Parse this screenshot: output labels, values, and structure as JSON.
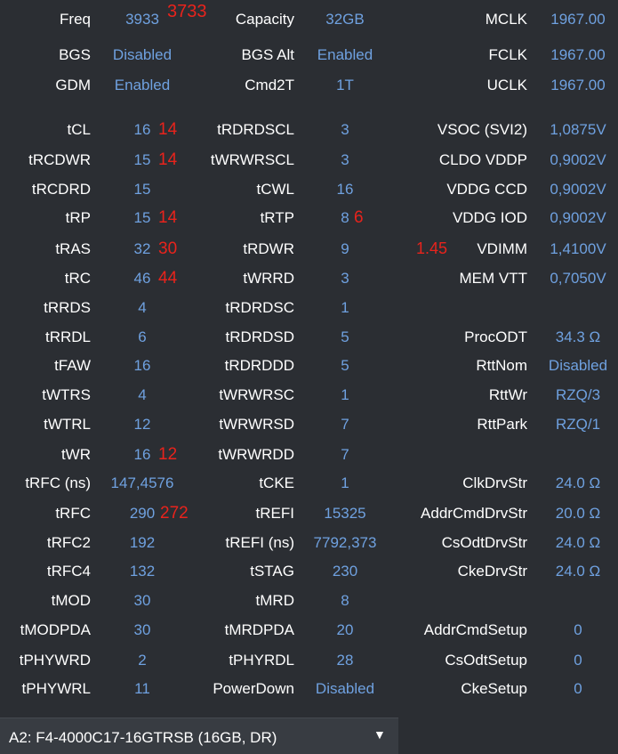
{
  "rows": [
    {
      "l1": "Freq",
      "v1": "3933",
      "a1": "3733",
      "l2": "Capacity",
      "v2": "32GB",
      "l3": "MCLK",
      "v3": "1967.00"
    },
    {
      "l1": "BGS",
      "v1": "Disabled",
      "l2": "BGS Alt",
      "v2": "Enabled",
      "l3": "FCLK",
      "v3": "1967.00"
    },
    {
      "l1": "GDM",
      "v1": "Enabled",
      "l2": "Cmd2T",
      "v2": "1T",
      "l3": "UCLK",
      "v3": "1967.00"
    },
    {
      "l1": "tCL",
      "v1": "16",
      "a1": "14",
      "l2": "tRDRDSCL",
      "v2": "3",
      "l3": "VSOC (SVI2)",
      "v3": "1,0875V"
    },
    {
      "l1": "tRCDWR",
      "v1": "15",
      "a1": "14",
      "l2": "tWRWRSCL",
      "v2": "3",
      "l3": "CLDO VDDP",
      "v3": "0,9002V"
    },
    {
      "l1": "tRCDRD",
      "v1": "15",
      "l2": "tCWL",
      "v2": "16",
      "l3": "VDDG CCD",
      "v3": "0,9002V"
    },
    {
      "l1": "tRP",
      "v1": "15",
      "a1": "14",
      "l2": "tRTP",
      "v2": "8",
      "a2": "6",
      "l3": "VDDG IOD",
      "v3": "0,9002V"
    },
    {
      "l1": "tRAS",
      "v1": "32",
      "a1": "30",
      "l2": "tRDWR",
      "v2": "9",
      "a3": "1.45",
      "l3": "VDIMM",
      "v3": "1,4100V"
    },
    {
      "l1": "tRC",
      "v1": "46",
      "a1": "44",
      "l2": "tWRRD",
      "v2": "3",
      "l3": "MEM VTT",
      "v3": "0,7050V"
    },
    {
      "l1": "tRRDS",
      "v1": "4",
      "l2": "tRDRDSC",
      "v2": "1",
      "l3": "",
      "v3": ""
    },
    {
      "l1": "tRRDL",
      "v1": "6",
      "l2": "tRDRDSD",
      "v2": "5",
      "l3": "ProcODT",
      "v3": "34.3 Ω"
    },
    {
      "l1": "tFAW",
      "v1": "16",
      "l2": "tRDRDDD",
      "v2": "5",
      "l3": "RttNom",
      "v3": "Disabled"
    },
    {
      "l1": "tWTRS",
      "v1": "4",
      "l2": "tWRWRSC",
      "v2": "1",
      "l3": "RttWr",
      "v3": "RZQ/3"
    },
    {
      "l1": "tWTRL",
      "v1": "12",
      "l2": "tWRWRSD",
      "v2": "7",
      "l3": "RttPark",
      "v3": "RZQ/1"
    },
    {
      "l1": "tWR",
      "v1": "16",
      "a1": "12",
      "l2": "tWRWRDD",
      "v2": "7",
      "l3": "",
      "v3": ""
    },
    {
      "l1": "tRFC (ns)",
      "v1": "147,4576",
      "l2": "tCKE",
      "v2": "1",
      "l3": "ClkDrvStr",
      "v3": "24.0 Ω"
    },
    {
      "l1": "tRFC",
      "v1": "290",
      "a1": "272",
      "l2": "tREFI",
      "v2": "15325",
      "l3": "AddrCmdDrvStr",
      "v3": "20.0 Ω"
    },
    {
      "l1": "tRFC2",
      "v1": "192",
      "l2": "tREFI (ns)",
      "v2": "7792,373",
      "l3": "CsOdtDrvStr",
      "v3": "24.0 Ω"
    },
    {
      "l1": "tRFC4",
      "v1": "132",
      "l2": "tSTAG",
      "v2": "230",
      "l3": "CkeDrvStr",
      "v3": "24.0 Ω"
    },
    {
      "l1": "tMOD",
      "v1": "30",
      "l2": "tMRD",
      "v2": "8",
      "l3": "",
      "v3": ""
    },
    {
      "l1": "tMODPDA",
      "v1": "30",
      "l2": "tMRDPDA",
      "v2": "20",
      "l3": "AddrCmdSetup",
      "v3": "0"
    },
    {
      "l1": "tPHYWRD",
      "v1": "2",
      "l2": "tPHYRDL",
      "v2": "28",
      "l3": "CsOdtSetup",
      "v3": "0"
    },
    {
      "l1": "tPHYWRL",
      "v1": "11",
      "l2": "PowerDown",
      "v2": "Disabled",
      "l3": "CkeSetup",
      "v3": "0"
    }
  ],
  "dropdown": {
    "selected": "A2: F4-4000C17-16GTRSB (16GB, DR)",
    "arrow_icon": "chevron-down-icon"
  },
  "colors": {
    "background": "#2b2e33",
    "label": "#ffffff",
    "value": "#6fa1e0",
    "annotation": "#e8231c"
  }
}
